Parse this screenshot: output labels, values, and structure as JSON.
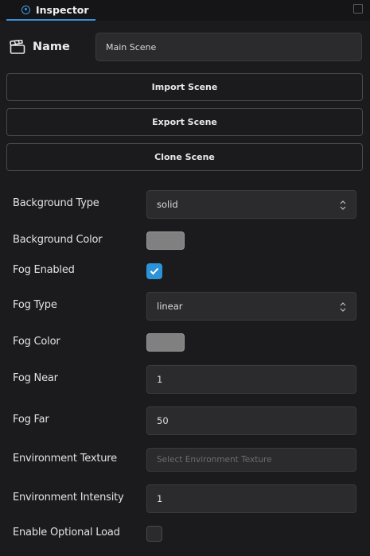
{
  "tab": {
    "title": "Inspector"
  },
  "name_row": {
    "label": "Name",
    "value": "Main Scene"
  },
  "buttons": {
    "import": "Import Scene",
    "export": "Export Scene",
    "clone": "Clone Scene"
  },
  "properties": {
    "background_type": {
      "label": "Background Type",
      "value": "solid"
    },
    "background_color": {
      "label": "Background Color",
      "color": "#808080"
    },
    "fog_enabled": {
      "label": "Fog Enabled",
      "checked": true
    },
    "fog_type": {
      "label": "Fog Type",
      "value": "linear"
    },
    "fog_color": {
      "label": "Fog Color",
      "color": "#808080"
    },
    "fog_near": {
      "label": "Fog Near",
      "value": "1"
    },
    "fog_far": {
      "label": "Fog Far",
      "value": "50"
    },
    "environment_texture": {
      "label": "Environment Texture",
      "placeholder": "Select Environment Texture"
    },
    "environment_intensity": {
      "label": "Environment Intensity",
      "value": "1"
    },
    "enable_optional_load": {
      "label": "Enable Optional Load",
      "checked": false
    }
  },
  "colors": {
    "accent": "#2d93d9",
    "background": "#1b1b1d",
    "field": "#2b2b2e"
  }
}
